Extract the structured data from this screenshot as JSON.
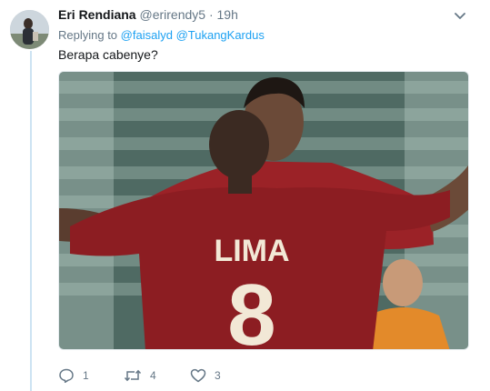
{
  "tweet": {
    "display_name": "Eri Rendiana",
    "handle": "@erirendy5",
    "separator": "·",
    "time": "19h",
    "replying_prefix": "Replying to",
    "mentions": [
      "@faisalyd",
      "@TukangKardus"
    ],
    "text": "Berapa cabenye?"
  },
  "media": {
    "jersey_name": "LIMA",
    "jersey_number": "8"
  },
  "actions": {
    "reply_count": "1",
    "retweet_count": "4",
    "like_count": "3"
  },
  "icons": [
    "avatar-image",
    "caret-down-icon",
    "reply-icon",
    "retweet-icon",
    "like-icon"
  ],
  "colors": {
    "link": "#1da1f2",
    "muted": "#657786",
    "thread_line": "#cde3f2",
    "jersey": "#8c1d22",
    "jersey_text": "#f2e8d6"
  }
}
